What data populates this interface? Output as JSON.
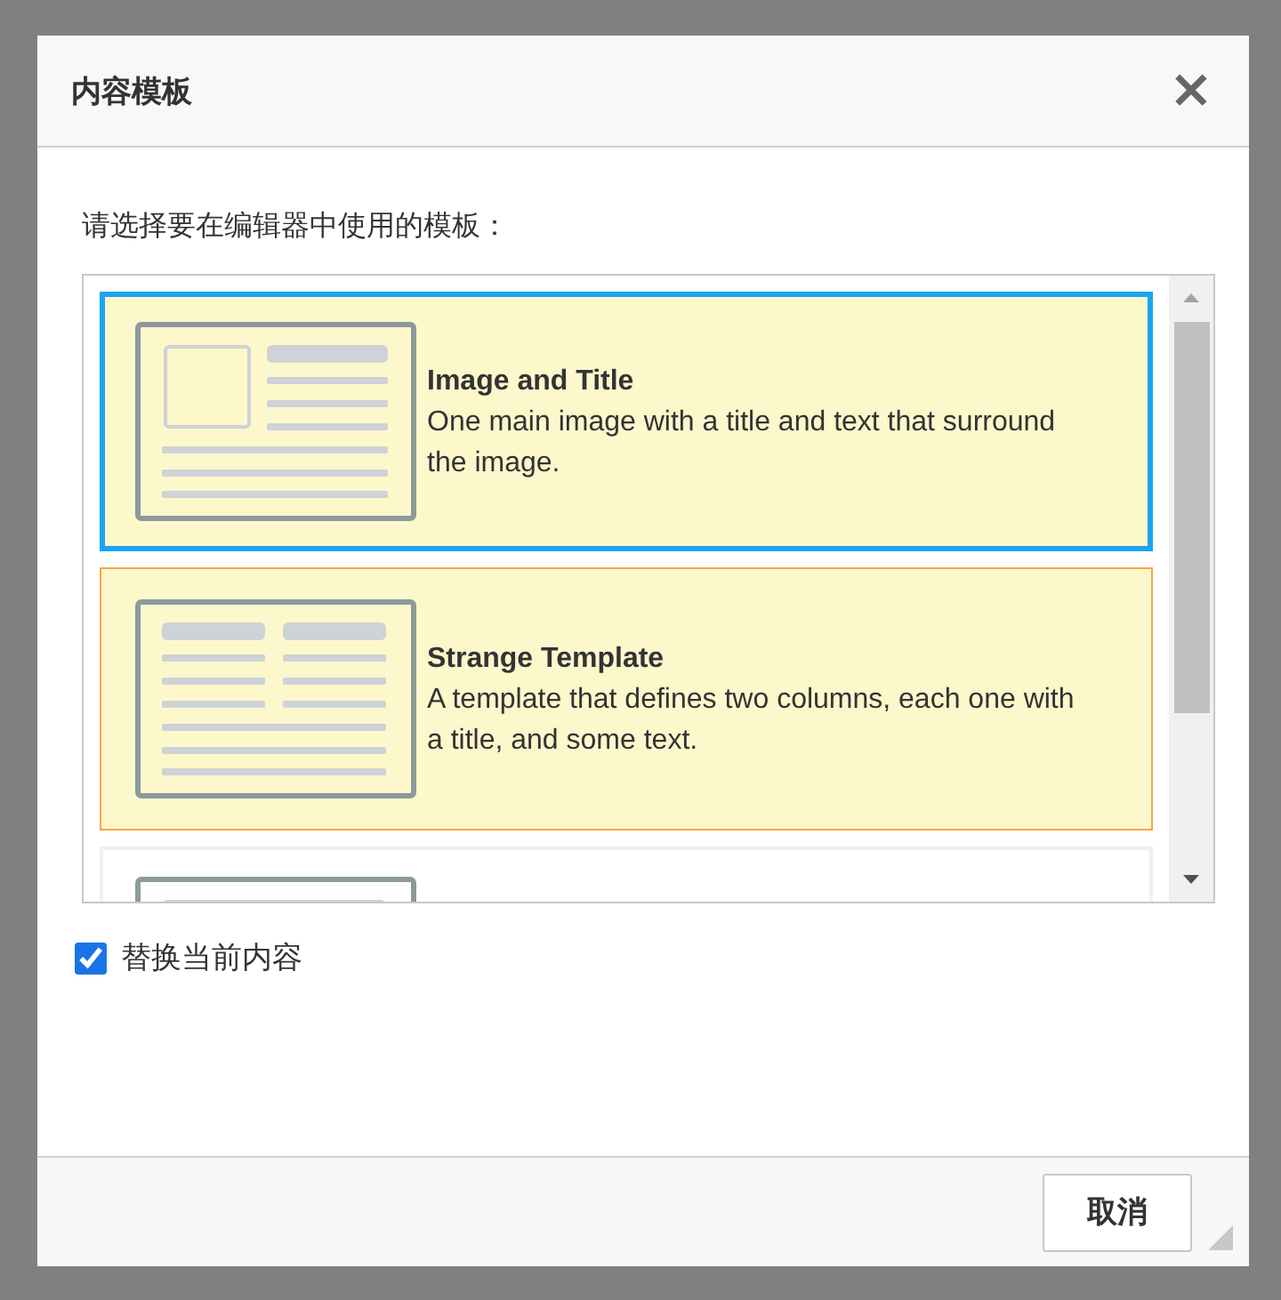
{
  "dialog": {
    "title": "内容模板",
    "close": "×"
  },
  "prompt": "请选择要在编辑器中使用的模板：",
  "templates": [
    {
      "kind": "image-title",
      "title": "Image and Title",
      "description": "One main image with a title and text that surround the image.",
      "selected": true,
      "hovered": false
    },
    {
      "kind": "two-columns",
      "title": "Strange Template",
      "description": "A template that defines two columns, each one with a title, and some text.",
      "selected": false,
      "hovered": true
    },
    {
      "kind": "text-only",
      "selected": false,
      "hovered": false
    }
  ],
  "replace_content": {
    "label": "替换当前内容",
    "checked": true
  },
  "buttons": [
    {
      "label": "取消"
    }
  ]
}
